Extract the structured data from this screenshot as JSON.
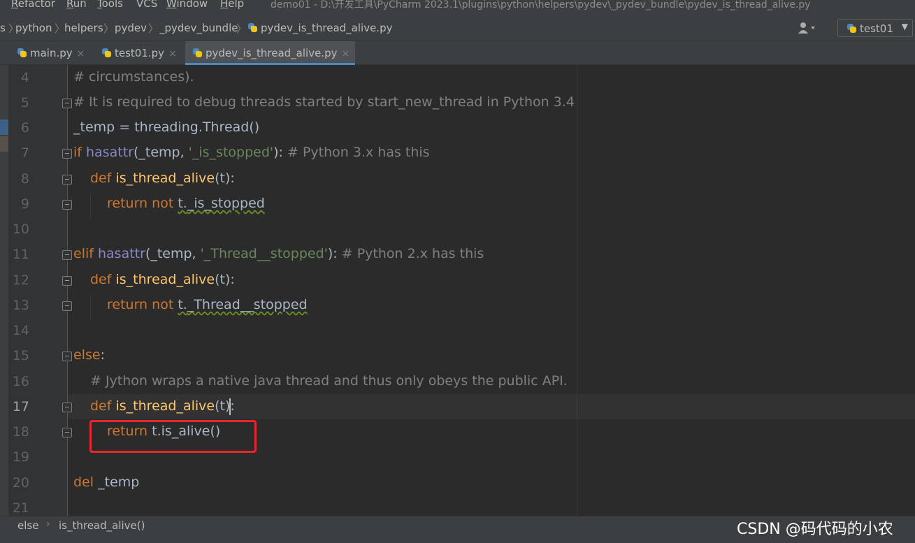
{
  "menu": {
    "items": [
      {
        "mnemonic": "R",
        "rest": "efactor"
      },
      {
        "mnemonic": "R",
        "rest": "un"
      },
      {
        "mnemonic": "T",
        "rest": "ools"
      },
      {
        "mnemonic": "",
        "rest": "VCS"
      },
      {
        "mnemonic": "W",
        "rest": "indow"
      },
      {
        "mnemonic": "H",
        "rest": "elp"
      }
    ],
    "window_title": "demo01 - D:\\开发工具\\PyCharm 2023.1\\plugins\\python\\helpers\\pydev\\_pydev_bundle\\pydev_is_thread_alive.py"
  },
  "breadcrumbs": {
    "partial": "s",
    "items": [
      "python",
      "helpers",
      "pydev",
      "_pydev_bundle",
      "pydev_is_thread_alive.py"
    ]
  },
  "toolbar": {
    "user_icon": "user-icon",
    "run_config": "test01",
    "dropdown_arrow": "▼"
  },
  "tabs": [
    {
      "label": "main.py",
      "close": "×",
      "active": false
    },
    {
      "label": "test01.py",
      "close": "×",
      "active": false
    },
    {
      "label": "pydev_is_thread_alive.py",
      "close": "×",
      "active": true
    }
  ],
  "editor": {
    "current_line": "17",
    "line_numbers": [
      "4",
      "5",
      "6",
      "7",
      "8",
      "9",
      "10",
      "11",
      "12",
      "13",
      "14",
      "15",
      "16",
      "17",
      "18",
      "19",
      "20",
      "21"
    ],
    "code": {
      "l4": {
        "c1": "# circumstances)."
      },
      "l5": {
        "c1": "# It is required to debug threads started by start_new_thread in Python 3.4"
      },
      "l6": {
        "t1": "_temp = threading.Thread()"
      },
      "l7": {
        "kw": "if",
        "bi": "hasattr",
        "t1": "(_temp, ",
        "str": "'_is_stopped'",
        "t2": "):",
        "c1": "# Python 3.x has this"
      },
      "l8": {
        "kw": "def",
        "fn": "is_thread_alive",
        "t1": "(t):"
      },
      "l9": {
        "kw1": "return",
        "kw2": "not",
        "t1": "t.",
        "t2": "_is_stopped"
      },
      "l11": {
        "kw": "elif",
        "bi": "hasattr",
        "t1": "(_temp, ",
        "str": "'_Thread__stopped'",
        "t2": "):",
        "c1": "# Python 2.x has this"
      },
      "l12": {
        "kw": "def",
        "fn": "is_thread_alive",
        "t1": "(t):"
      },
      "l13": {
        "kw1": "return",
        "kw2": "not",
        "t1": "t.",
        "t2": "_Thread__stopped"
      },
      "l15": {
        "kw": "else",
        "t1": ":"
      },
      "l16": {
        "c1": "# Jython wraps a native java thread and thus only obeys the public API."
      },
      "l17": {
        "kw": "def",
        "fn": "is_thread_alive",
        "t1": "(t):"
      },
      "l18": {
        "kw": "return",
        "t1": "t.is_alive()"
      },
      "l20": {
        "kw": "del",
        "t1": "_temp"
      }
    }
  },
  "status": {
    "crumbs": [
      "else",
      "is_thread_alive()"
    ],
    "separator": "›",
    "watermark": "CSDN @码代码的小农"
  },
  "colors": {
    "keyword": "#cc7832",
    "function": "#ffc66d",
    "builtin": "#8888c6",
    "string": "#6a8759",
    "comment": "#808080",
    "highlight_box": "#e8262e",
    "accent": "#4a88c7"
  }
}
